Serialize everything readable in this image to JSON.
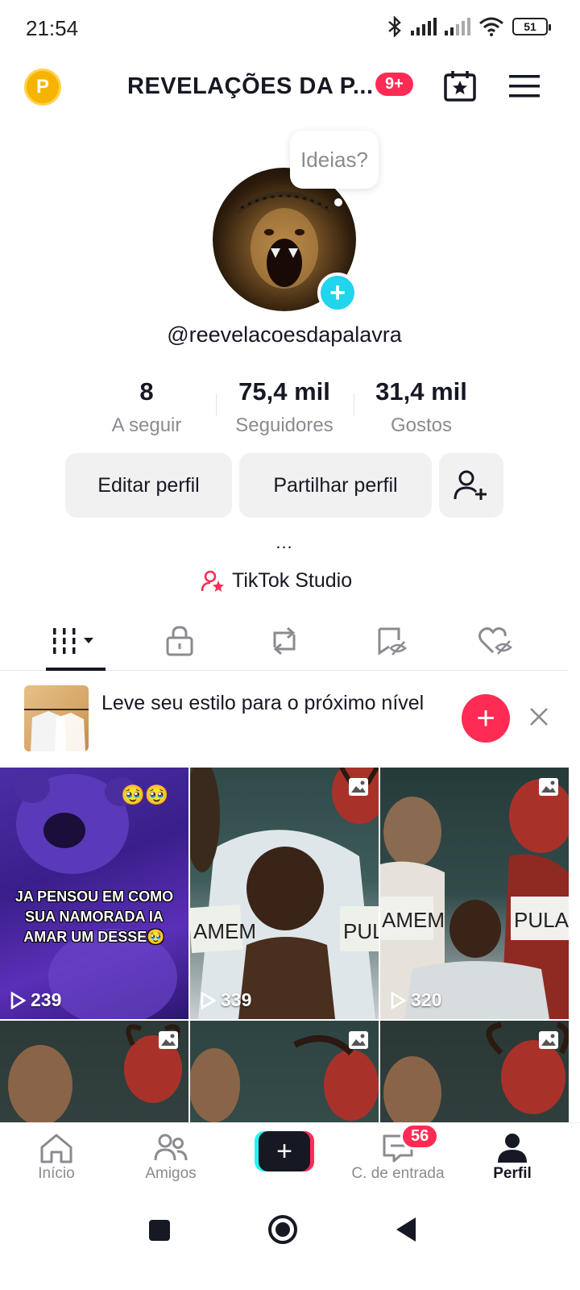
{
  "status": {
    "time": "21:54",
    "battery": "51"
  },
  "header": {
    "title": "REVELAÇÕES DA P...",
    "badge": "9+",
    "coin_letter": "P"
  },
  "profile": {
    "bubble": "Ideias?",
    "username": "@reevelacoesdapalavra",
    "stats": [
      {
        "value": "8",
        "label": "A seguir"
      },
      {
        "value": "75,4 mil",
        "label": "Seguidores"
      },
      {
        "value": "31,4 mil",
        "label": "Gostos"
      }
    ],
    "edit_label": "Editar perfil",
    "share_label": "Partilhar perfil",
    "ellipsis": "...",
    "studio_label": "TikTok Studio"
  },
  "promo": {
    "text": "Leve seu estilo para o próximo nível"
  },
  "grid": {
    "tiles": [
      {
        "views": "239",
        "caption": "JA PENSOU EM COMO SUA NAMORADA IA AMAR UM DESSE🥹",
        "type": "video"
      },
      {
        "views": "339",
        "type": "photo",
        "sign_left": "AMEM",
        "sign_right": "PUL"
      },
      {
        "views": "320",
        "type": "photo",
        "sign_left": "AMEM",
        "sign_right": "PULAR"
      },
      {
        "type": "photo"
      },
      {
        "type": "photo"
      },
      {
        "type": "photo"
      }
    ]
  },
  "nav": {
    "home": "Início",
    "friends": "Amigos",
    "inbox": "C. de entrada",
    "inbox_badge": "56",
    "profile": "Perfil"
  },
  "colors": {
    "accent": "#fe2c55",
    "cyan": "#20d5ec",
    "text": "#161823",
    "muted": "#8a8b91"
  }
}
